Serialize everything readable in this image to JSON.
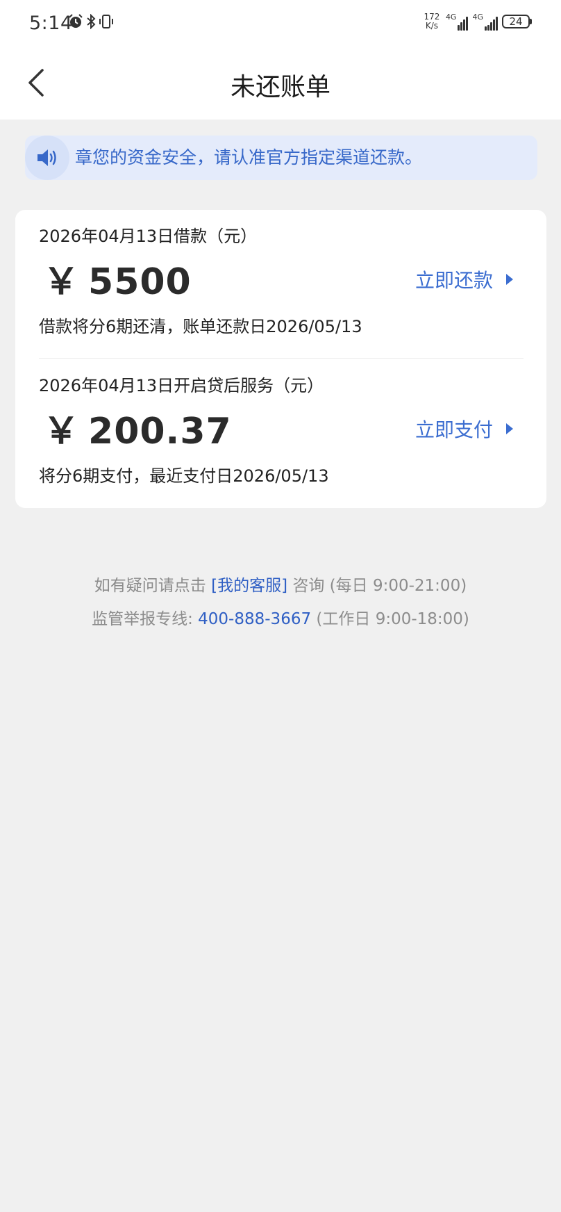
{
  "status_bar": {
    "time": "5:14",
    "net_speed_value": "172",
    "net_speed_unit": "K/s",
    "signal1_label": "4G",
    "signal2_label": "4G",
    "battery": "24",
    "icons": [
      "alarm-icon",
      "bluetooth-icon",
      "vibrate-icon"
    ]
  },
  "header": {
    "title": "未还账单"
  },
  "notice": {
    "icon": "speaker-icon",
    "text": "章您的资金安全，请认准官方指定渠道还款。",
    "accent": "#3768c9",
    "background": "#e4ebfb"
  },
  "bills": [
    {
      "date_label": "2026年04月13日借款（元）",
      "currency": "￥",
      "amount": "5500",
      "description": "借款将分6期还清，账单还款日2026/05/13",
      "action_label": "立即还款"
    },
    {
      "date_label": "2026年04月13日开启贷后服务（元）",
      "currency": "￥",
      "amount": "200.37",
      "description": "将分6期支付，最近支付日2026/05/13",
      "action_label": "立即支付"
    }
  ],
  "footer": {
    "line1_prefix": "如有疑问请点击",
    "line1_link": "[我的客服]",
    "line1_suffix": "咨询 (每日 9:00-21:00)",
    "line2_prefix": "监管举报专线:",
    "line2_phone": "400-888-3667",
    "line2_suffix": "(工作日 9:00-18:00)"
  },
  "colors": {
    "page_background": "#f0f0f0",
    "link_blue": "#3b6dd0"
  }
}
